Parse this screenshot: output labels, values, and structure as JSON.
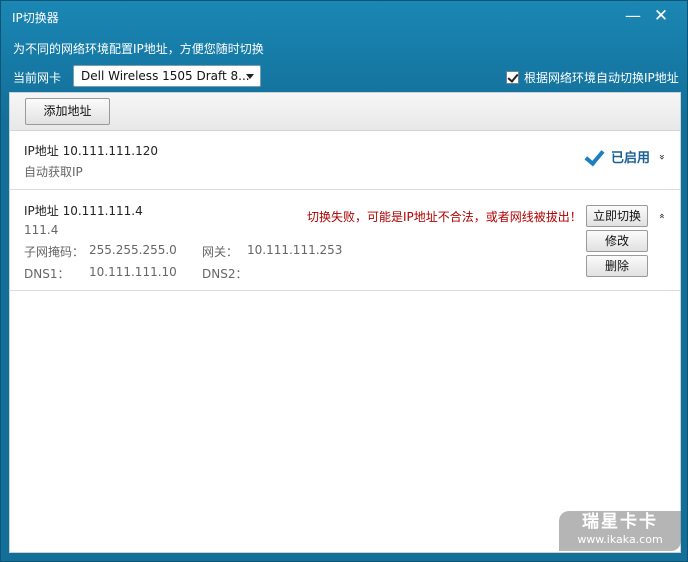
{
  "window": {
    "title": "IP切换器",
    "subtitle": "为不同的网络环境配置IP地址，方便您随时切换",
    "minimize_glyph": "—",
    "close_glyph": "✕"
  },
  "nic": {
    "label": "当前网卡",
    "selected": "Dell Wireless 1505 Draft 8...",
    "auto_switch_label": "根据网络环境自动切换IP地址",
    "auto_switch_checked": true
  },
  "toolbar": {
    "add_label": "添加地址"
  },
  "profiles": [
    {
      "ip_label": "IP地址  10.111.111.120",
      "mode": "自动获取IP",
      "status": "已启用",
      "expand_glyph": "»"
    },
    {
      "ip_label": "IP地址  10.111.111.4",
      "ip_sub": "111.4",
      "subnet_label": "子网掩码：",
      "subnet_value": "255.255.255.0",
      "gateway_label": "网关：",
      "gateway_value": "10.111.111.253",
      "dns1_label": "DNS1：",
      "dns1_value": "10.111.111.10",
      "dns2_label": "DNS2：",
      "dns2_value": "",
      "error": "切换失败，可能是IP地址不合法，或者网线被拔出！",
      "switch_label": "立即切换",
      "edit_label": "修改",
      "delete_label": "删除",
      "expand_glyph": "«"
    }
  ],
  "watermark": {
    "brand": "瑞星卡卡",
    "url": "www.ikaka.com"
  }
}
